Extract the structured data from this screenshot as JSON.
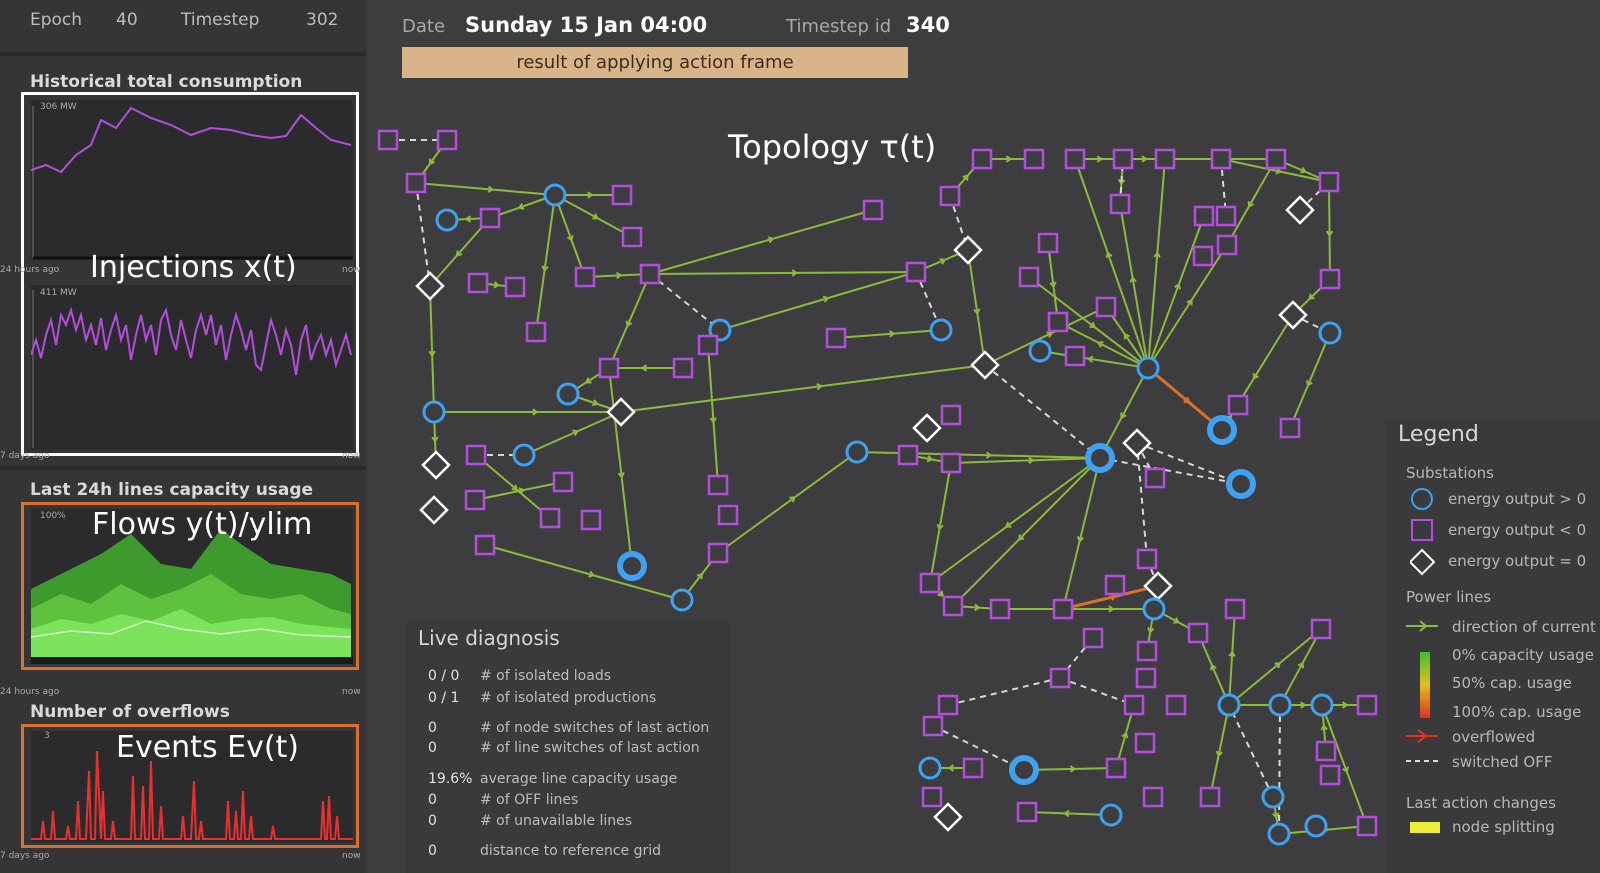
{
  "left": {
    "epoch_label": "Epoch",
    "epoch_value": "40",
    "timestep_label": "Timestep",
    "timestep_value": "302",
    "hist_title": "Historical total consumption",
    "hist_top_label": "306 MW",
    "hist_left_time": "24 hours ago",
    "hist_right_time": "now",
    "hist_overlay": "Injections x(t)",
    "hist2_top_label": "411 MW",
    "hist2_left_time": "7 days ago",
    "hist2_right_time": "now",
    "lines_title": "Last 24h lines capacity usage",
    "lines_top_label": "100%",
    "lines_overlay": "Flows y(t)/ylim",
    "lines_left_time": "24 hours ago",
    "lines_right_time": "now",
    "overflow_title": "Number of overflows",
    "overflow_top_label": "3",
    "overflow_overlay": "Events Ev(t)",
    "overflow_left_time": "7 days ago",
    "overflow_right_time": "now"
  },
  "header": {
    "date_label": "Date",
    "date_value": "Sunday 15 Jan  04:00",
    "timestep_id_label": "Timestep id",
    "timestep_id_value": "340",
    "action_frame": "result of applying action frame"
  },
  "topology_label": "Topology τ(t)",
  "diagnosis": {
    "title": "Live diagnosis",
    "rows": [
      {
        "value": "0 / 0",
        "label": "# of isolated loads"
      },
      {
        "value": "0 / 1",
        "label": "# of isolated productions"
      },
      {
        "value": "0",
        "label": "# of node switches of last action"
      },
      {
        "value": "0",
        "label": "# of line switches of last action"
      },
      {
        "value": "19.6%",
        "label": "average line capacity usage"
      },
      {
        "value": "0",
        "label": "# of OFF lines"
      },
      {
        "value": "0",
        "label": "# of unavailable lines"
      },
      {
        "value": "0",
        "label": "distance to reference grid"
      }
    ]
  },
  "legend": {
    "title": "Legend",
    "substations_header": "Substations",
    "sub_positive": "energy output > 0",
    "sub_negative": "energy output < 0",
    "sub_zero": "energy output = 0",
    "power_lines_header": "Power lines",
    "direction": "direction of current",
    "cap0": "0% capacity usage",
    "cap50": "50% cap. usage",
    "cap100": "100% cap. usage",
    "overflowed": "overflowed",
    "switched_off": "switched OFF",
    "last_action_header": "Last action changes",
    "node_splitting": "node splitting"
  },
  "colors": {
    "purple": "#b14fdc",
    "blue": "#3ea2f0",
    "line_green": "#8cba3c",
    "highlight_white": "#ffffff",
    "highlight_orange": "#d9712b",
    "action_tan": "#d9b489"
  }
}
